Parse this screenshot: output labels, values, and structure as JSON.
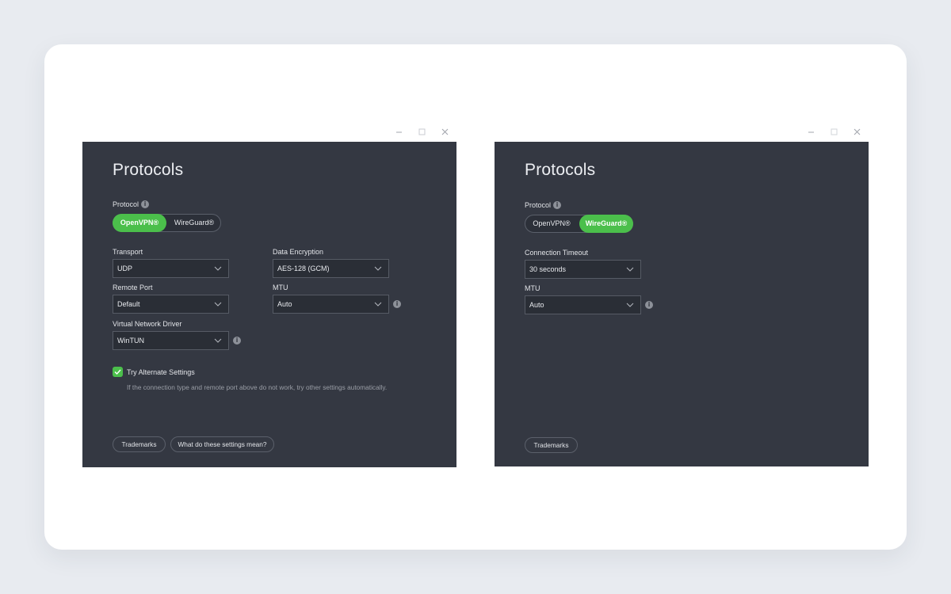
{
  "colors": {
    "page_bg": "#e8ebf0",
    "panel_bg": "#343842",
    "accent": "#4bbf4b"
  },
  "left_window": {
    "window_controls": [
      "minimize-icon",
      "maximize-icon",
      "close-icon"
    ],
    "title": "Protocols",
    "protocol_label": "Protocol",
    "protocol_options": [
      "OpenVPN®",
      "WireGuard®"
    ],
    "protocol_selected": "OpenVPN®",
    "transport": {
      "label": "Transport",
      "value": "UDP"
    },
    "data_encryption": {
      "label": "Data Encryption",
      "value": "AES-128 (GCM)"
    },
    "remote_port": {
      "label": "Remote Port",
      "value": "Default"
    },
    "mtu": {
      "label": "MTU",
      "value": "Auto"
    },
    "virtual_network_driver": {
      "label": "Virtual Network Driver",
      "value": "WinTUN"
    },
    "try_alternate": {
      "label": "Try Alternate Settings",
      "checked": true,
      "hint": "If the connection type and remote port above do not work, try other settings automatically."
    },
    "trademarks_button": "Trademarks",
    "settings_help_button": "What do these settings mean?"
  },
  "right_window": {
    "window_controls": [
      "minimize-icon",
      "maximize-icon",
      "close-icon"
    ],
    "title": "Protocols",
    "protocol_label": "Protocol",
    "protocol_options": [
      "OpenVPN®",
      "WireGuard®"
    ],
    "protocol_selected": "WireGuard®",
    "connection_timeout": {
      "label": "Connection Timeout",
      "value": "30 seconds"
    },
    "mtu": {
      "label": "MTU",
      "value": "Auto"
    },
    "trademarks_button": "Trademarks"
  }
}
